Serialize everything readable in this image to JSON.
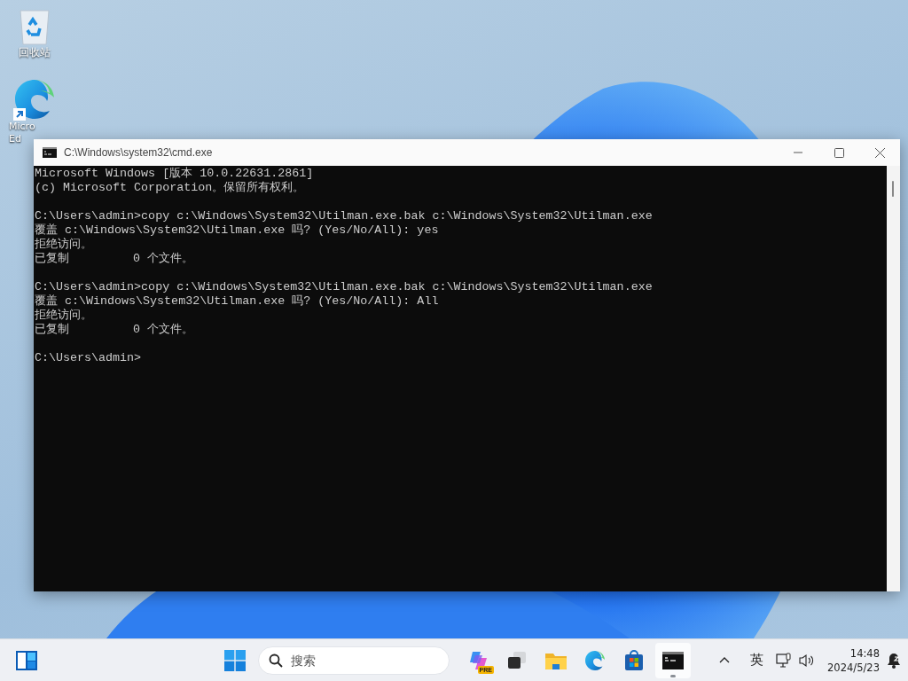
{
  "desktop_icons": [
    {
      "kind": "recycle-bin",
      "label_lines": [
        "回收站"
      ]
    },
    {
      "kind": "edge",
      "label_lines": [
        "Micro",
        "Ed"
      ]
    }
  ],
  "window": {
    "title": "C:\\Windows\\system32\\cmd.exe",
    "console_blocks": [
      [
        "Microsoft Windows [版本 10.0.22631.2861]",
        "(c) Microsoft Corporation。保留所有权利。"
      ],
      [
        "C:\\Users\\admin>copy c:\\Windows\\System32\\Utilman.exe.bak c:\\Windows\\System32\\Utilman.exe",
        "覆盖 c:\\Windows\\System32\\Utilman.exe 吗? (Yes/No/All): yes",
        "拒绝访问。",
        "已复制         0 个文件。"
      ],
      [
        "C:\\Users\\admin>copy c:\\Windows\\System32\\Utilman.exe.bak c:\\Windows\\System32\\Utilman.exe",
        "覆盖 c:\\Windows\\System32\\Utilman.exe 吗? (Yes/No/All): All",
        "拒绝访问。",
        "已复制         0 个文件。"
      ],
      [
        "C:\\Users\\admin>"
      ]
    ]
  },
  "taskbar": {
    "search_placeholder": "搜索",
    "apps": [
      {
        "kind": "copilot",
        "badge": "PRE",
        "active": false
      },
      {
        "kind": "task-view",
        "active": false
      },
      {
        "kind": "explorer",
        "active": false
      },
      {
        "kind": "edge",
        "active": false
      },
      {
        "kind": "store",
        "active": false
      },
      {
        "kind": "terminal",
        "active": true
      }
    ],
    "tray": {
      "input_method": "英",
      "time": "14:48",
      "date": "2024/5/23"
    }
  }
}
